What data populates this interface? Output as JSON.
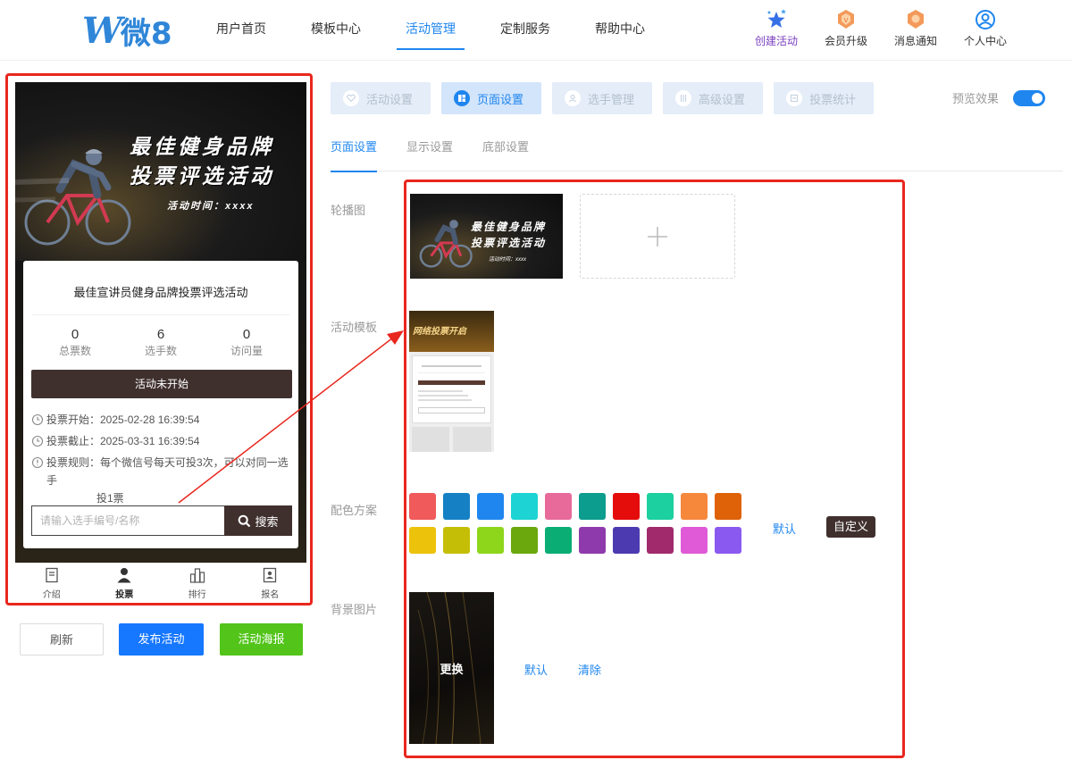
{
  "header": {
    "logo_mark": "W",
    "logo_text": "微8",
    "nav": [
      {
        "label": "用户首页"
      },
      {
        "label": "模板中心"
      },
      {
        "label": "活动管理"
      },
      {
        "label": "定制服务"
      },
      {
        "label": "帮助中心"
      }
    ],
    "active_nav": "活动管理",
    "tools": [
      {
        "label": "创建活动",
        "icon": "stars-icon"
      },
      {
        "label": "会员升级",
        "icon": "vip-badge-icon"
      },
      {
        "label": "消息通知",
        "icon": "message-badge-icon"
      },
      {
        "label": "个人中心",
        "icon": "user-circle-icon"
      }
    ]
  },
  "preview": {
    "banner": {
      "title_line1": "最佳健身品牌",
      "title_line2": "投票评选活动",
      "time": "活动时间：xxxx"
    },
    "card": {
      "title": "最佳宣讲员健身品牌投票评选活动",
      "stats": [
        {
          "value": "0",
          "label": "总票数"
        },
        {
          "value": "6",
          "label": "选手数"
        },
        {
          "value": "0",
          "label": "访问量"
        }
      ],
      "status_button": "活动未开始",
      "vote_start": "投票开始：2025-02-28 16:39:54",
      "vote_end": "投票截止：2025-03-31 16:39:54",
      "rule_line1": "投票规则：每个微信号每天可投3次，可以对同一选手",
      "rule_line2": "投1票",
      "search_placeholder": "请输入选手编号/名称",
      "search_button": "搜索"
    },
    "tabbar": [
      {
        "label": "介绍",
        "icon": "document-icon"
      },
      {
        "label": "投票",
        "icon": "person-icon"
      },
      {
        "label": "排行",
        "icon": "ranking-icon"
      },
      {
        "label": "报名",
        "icon": "signup-icon"
      }
    ]
  },
  "actions": {
    "refresh": "刷新",
    "publish": "发布活动",
    "poster": "活动海报"
  },
  "settings": {
    "tabs": [
      {
        "label": "活动设置",
        "icon": "heart-icon"
      },
      {
        "label": "页面设置",
        "icon": "layout-icon"
      },
      {
        "label": "选手管理",
        "icon": "contestant-icon"
      },
      {
        "label": "高级设置",
        "icon": "advanced-icon"
      },
      {
        "label": "投票统计",
        "icon": "stats-icon"
      }
    ],
    "active_tab": "页面设置",
    "preview_label": "预览效果",
    "preview_on": true,
    "subtabs": [
      {
        "label": "页面设置"
      },
      {
        "label": "显示设置"
      },
      {
        "label": "底部设置"
      }
    ],
    "fields": {
      "carousel": "轮播图",
      "template": "活动模板",
      "color_scheme": "配色方案",
      "background": "背景图片"
    },
    "carousel_thumb": {
      "line1": "最佳健身品牌",
      "line2": "投票评选活动",
      "time": "活动时间：xxxx"
    },
    "template_thumb_title": "网络投票开启",
    "colors": [
      "#f05a5a",
      "#1581c4",
      "#1f86ef",
      "#1ed3d3",
      "#e86a9a",
      "#0c9d8e",
      "#e50c0c",
      "#1dd0a0",
      "#f6883c",
      "#df6108",
      "#ecc20b",
      "#c4bf06",
      "#8ed61b",
      "#6aa80d",
      "#0aae74",
      "#8e3aac",
      "#4c3ab0",
      "#a12a6d",
      "#e05ad8",
      "#8a5af0"
    ],
    "color_default": "默认",
    "color_custom": "自定义",
    "background_change": "更换",
    "background_default": "默认",
    "background_clear": "清除"
  }
}
